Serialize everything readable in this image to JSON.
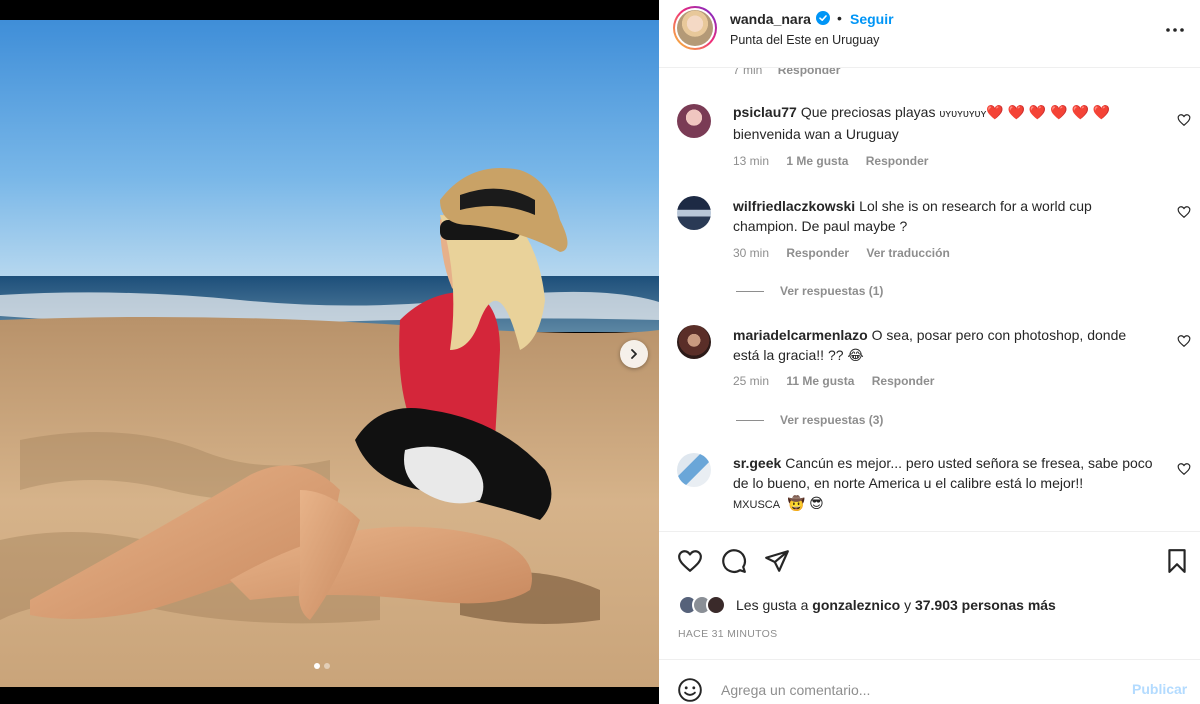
{
  "post": {
    "username": "wanda_nara",
    "follow_label": "Seguir",
    "separator": "•",
    "location": "Punta del Este en Uruguay"
  },
  "comments": {
    "partial_previous": {
      "time": "7 min",
      "reply": "Responder"
    },
    "items": [
      {
        "user": "psiclau77",
        "text": "Que preciosas playas ",
        "small_text": "ᴜʏᴜʏᴜʏᴜʏ",
        "emoji": "❤️ ❤️ ❤️ ❤️ ❤️ ❤️",
        "text2": "bienvenida wan a Uruguay",
        "time": "13 min",
        "likes": "1 Me gusta",
        "reply": "Responder"
      },
      {
        "user": "wilfriedlaczkowski",
        "text": "Lol she is on research for a world cup champion. De paul maybe ?",
        "time": "30 min",
        "reply": "Responder",
        "translate": "Ver traducción",
        "replies": "Ver respuestas (1)"
      },
      {
        "user": "mariadelcarmenlazo",
        "text": "O sea, posar pero con photoshop, donde está la gracia!! ?? ",
        "emoji": "😂",
        "time": "25 min",
        "likes": "11 Me gusta",
        "reply": "Responder",
        "replies": "Ver respuestas (3)"
      },
      {
        "user": "sr.geek",
        "text": "Cancún es mejor... pero usted señora se fresea, sabe poco de lo bueno, en norte America u el calibre está lo mejor!!",
        "small_text": "MXUSCA",
        "emoji": "🤠 😎"
      }
    ]
  },
  "likes": {
    "prefix": "Les gusta a ",
    "first_user": "gonzaleznico",
    "conjunction": " y ",
    "count_text": "37.903 personas más"
  },
  "timestamp": "HACE 31 MINUTOS",
  "add_comment": {
    "placeholder": "Agrega un comentario...",
    "publish_label": "Publicar"
  },
  "colors": {
    "accent": "#0095f6",
    "heart": "#ed4956",
    "muted": "#8e8e8e",
    "publish_disabled": "#b3dbff"
  },
  "icons": [
    "verified-icon",
    "more-options-icon",
    "heart-icon",
    "comment-icon",
    "share-icon",
    "bookmark-icon",
    "emoji-icon",
    "chevron-right-icon"
  ]
}
